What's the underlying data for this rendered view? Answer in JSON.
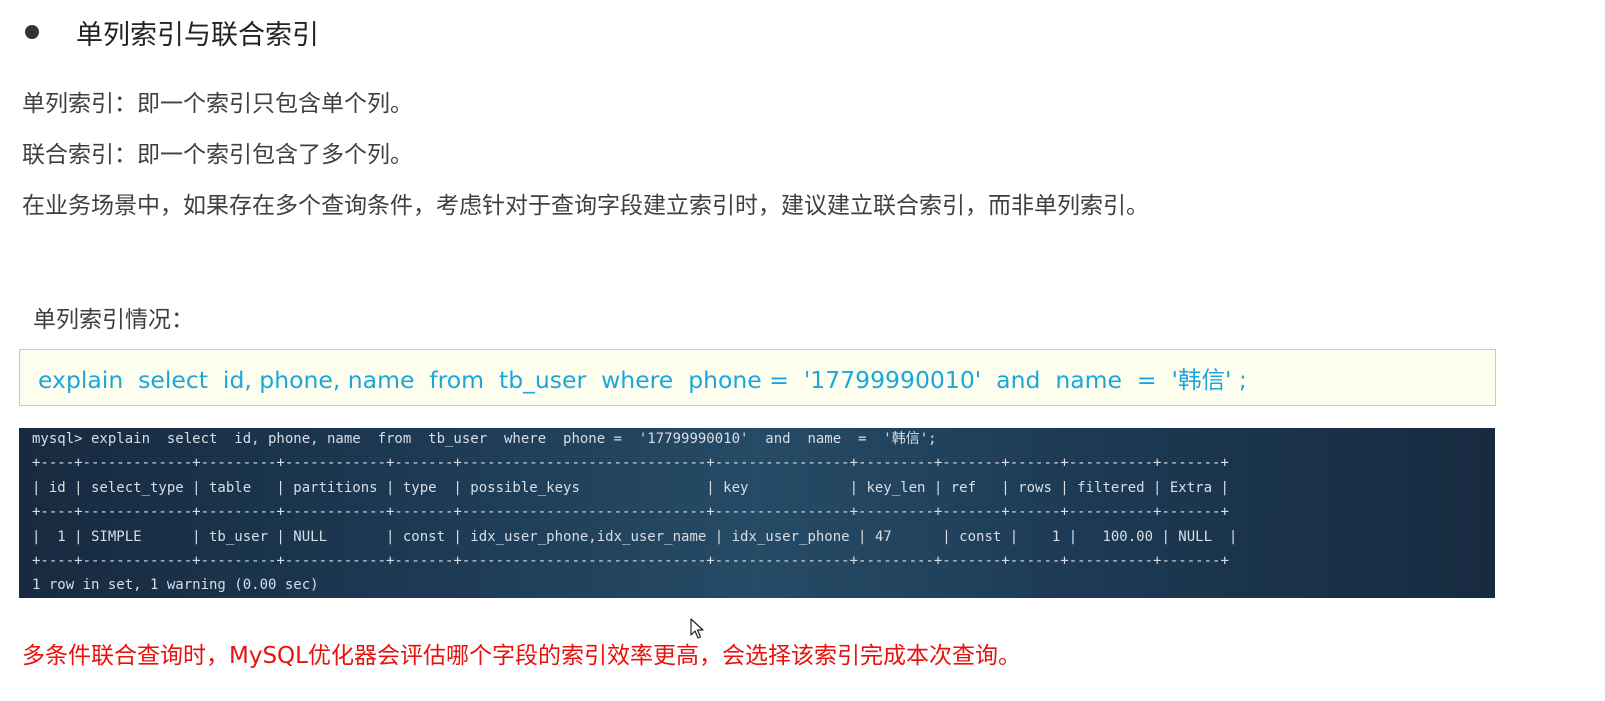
{
  "heading": {
    "title": "单列索引与联合索引"
  },
  "definitions": {
    "single": "单列索引：即一个索引只包含单个列。",
    "composite": "联合索引：即一个索引包含了多个列。",
    "advice": "在业务场景中，如果存在多个查询条件，考虑针对于查询字段建立索引时，建议建立联合索引，而非单列索引。"
  },
  "subheading": "单列索引情况：",
  "sql_statement": "explain  select  id, phone, name  from  tb_user  where  phone =  '17799990010'  and  name  =  '韩信' ;",
  "terminal": {
    "command": "mysql> explain  select  id, phone, name  from  tb_user  where  phone =  '17799990010'  and  name  =  '韩信';",
    "separator": "+----+-------------+---------+------------+-------+-----------------------------+----------------+---------+-------+------+----------+-------+",
    "header": "| id | select_type | table   | partitions | type  | possible_keys               | key            | key_len | ref   | rows | filtered | Extra |",
    "row": "|  1 | SIMPLE      | tb_user | NULL       | const | idx_user_phone,idx_user_name | idx_user_phone | 47      | const |    1 |   100.00 | NULL  |",
    "footer": "1 row in set, 1 warning (0.00 sec)"
  },
  "note": "多条件联合查询时，MySQL优化器会评估哪个字段的索引效率更高，会选择该索引完成本次查询。",
  "colors": {
    "sql_text": "#1aa7e0",
    "note_text": "#e8120c",
    "sql_box_bg": "#fefeee",
    "terminal_bg": "#1d3a55"
  },
  "icons": {
    "bullet": "bullet-dot-icon",
    "cursor": "mouse-pointer-icon"
  }
}
